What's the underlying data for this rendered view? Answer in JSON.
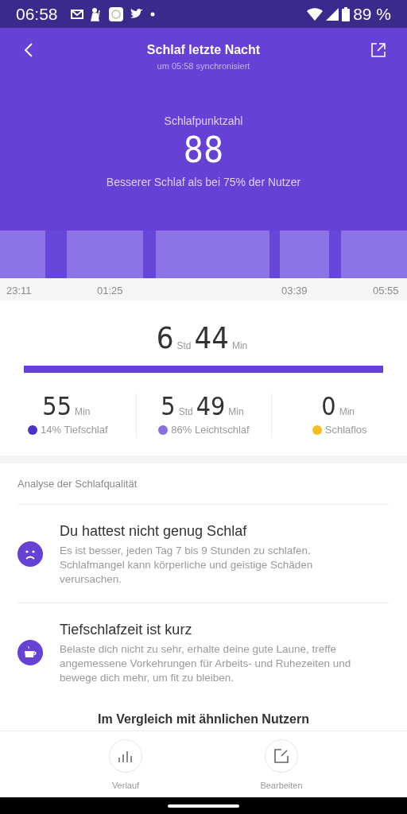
{
  "status_bar": {
    "time": "06:58",
    "battery": "89 %"
  },
  "header": {
    "title": "Schlaf letzte Nacht",
    "subtitle": "um 05:58 synchronisiert"
  },
  "score": {
    "label": "Schlafpunktzahl",
    "value": "88",
    "note": "Besserer Schlaf als bei 75% der Nutzer"
  },
  "timeline": {
    "ticks": [
      "23:11",
      "01:25",
      "03:39",
      "05:55"
    ]
  },
  "total": {
    "hours": "6",
    "hours_unit": "Std",
    "minutes": "44",
    "minutes_unit": "Min"
  },
  "stats": [
    {
      "parts": [
        {
          "value": "55",
          "unit": "Min"
        }
      ],
      "label": "14% Tiefschlaf",
      "color": "#4b32c8"
    },
    {
      "parts": [
        {
          "value": "5",
          "unit": "Std"
        },
        {
          "value": "49",
          "unit": "Min"
        }
      ],
      "label": "86% Leichtschlaf",
      "color": "#8a6fe0"
    },
    {
      "parts": [
        {
          "value": "0",
          "unit": "Min"
        }
      ],
      "label": "Schlaflos",
      "color": "#f5bd1f"
    }
  ],
  "analysis": {
    "heading": "Analyse der Schlafqualität",
    "items": [
      {
        "kind": "sad",
        "title": "Du hattest nicht genug Schlaf",
        "text": "Es ist besser, jeden Tag 7 bis 9 Stunden zu schlafen. Schlafmangel kann körperliche und geistige Schäden verursachen."
      },
      {
        "kind": "cup",
        "title": "Tiefschlafzeit ist kurz",
        "text": "Belaste dich nicht zu sehr, erhalte deine gute Laune, treffe angemessene Vorkehrungen für Arbeits- und Ruhezeiten und bewege dich mehr, um fit zu bleiben."
      }
    ]
  },
  "compare_heading": "Im Vergleich mit ähnlichen Nutzern",
  "bottom_nav": [
    {
      "kind": "chart",
      "label": "Verlauf"
    },
    {
      "kind": "edit",
      "label": "Bearbeiten"
    }
  ]
}
